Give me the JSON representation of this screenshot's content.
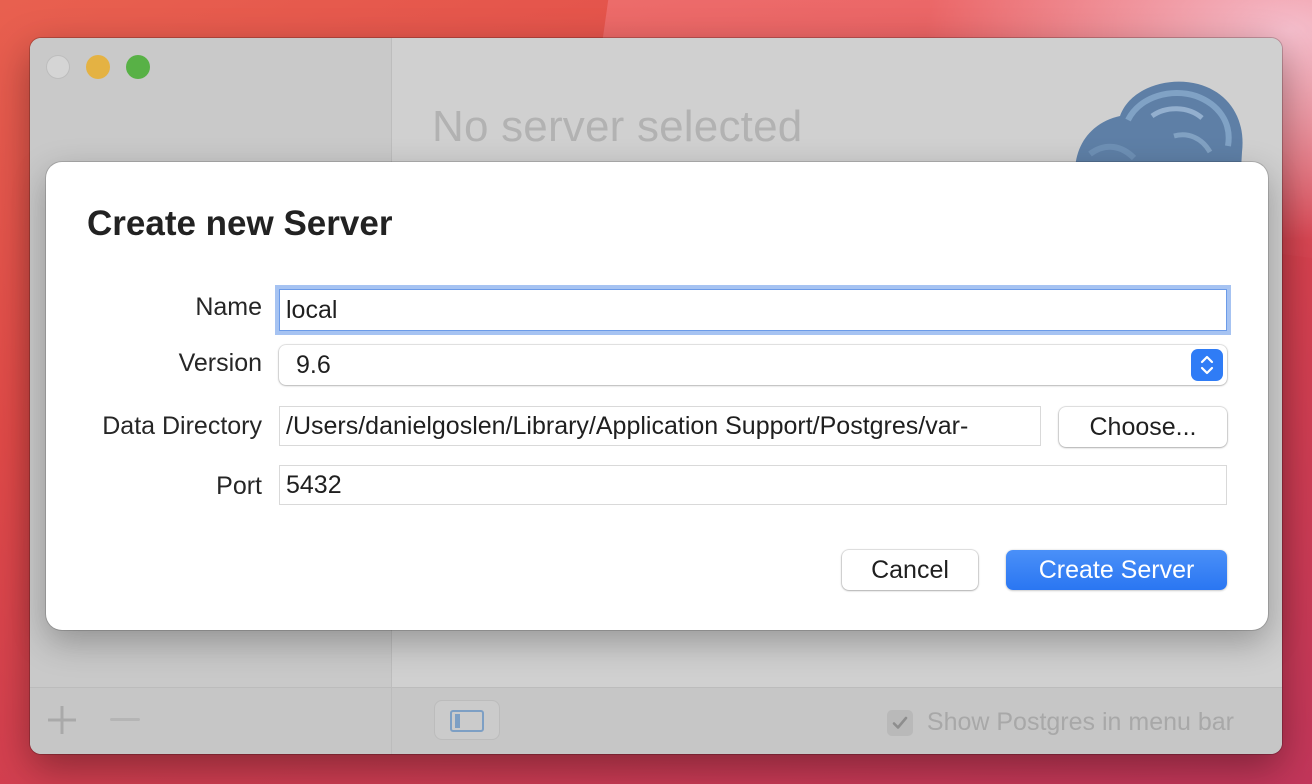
{
  "window": {
    "empty_state_title": "No server selected",
    "show_in_menubar_label": "Show Postgres in menu bar",
    "show_in_menubar_checked": true
  },
  "dialog": {
    "title": "Create new Server",
    "name_label": "Name",
    "name_value": "local",
    "version_label": "Version",
    "version_value": "9.6",
    "data_directory_label": "Data Directory",
    "data_directory_value": "/Users/danielgoslen/Library/Application Support/Postgres/var-",
    "choose_button": "Choose...",
    "port_label": "Port",
    "port_value": "5432",
    "cancel_button": "Cancel",
    "create_button": "Create Server"
  },
  "icons": {
    "add": "plus-icon",
    "remove": "minus-icon",
    "toggle_sidebar": "sidebar-icon",
    "stepper": "chevron-up-down-icon",
    "checkbox": "checkmark-icon",
    "app_logo": "elephant-logo"
  },
  "colors": {
    "accent": "#2f7cf6",
    "focus_ring": "#a6c3f2",
    "traffic_minimize": "#e4b243",
    "traffic_zoom": "#58b146"
  }
}
